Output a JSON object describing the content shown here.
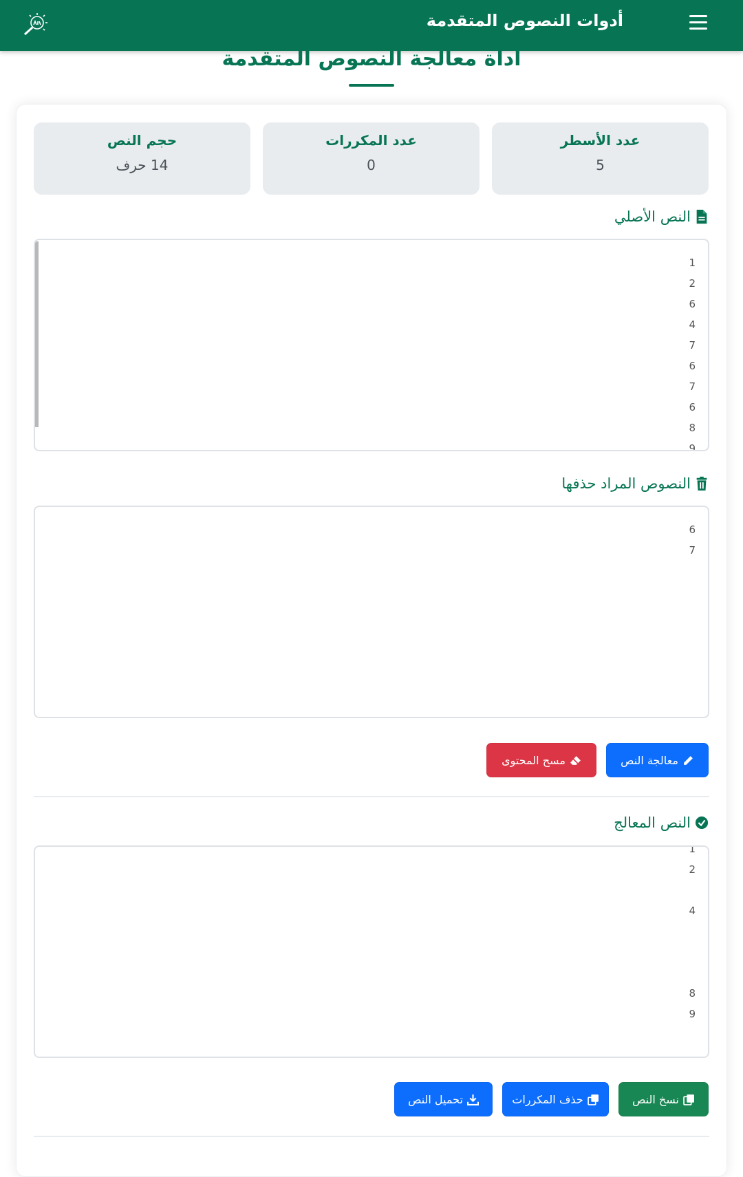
{
  "navbar": {
    "title": "أدوات النصوص المتقدمة",
    "logo_icon": "magnifier-logo-icon",
    "menu_icon": "hamburger-icon",
    "background": "#077554"
  },
  "page": {
    "title": "أداة معالجة النصوص المتقدمة"
  },
  "stats": {
    "lines": {
      "label": "عدد الأسطر",
      "value": "5"
    },
    "duplicates": {
      "label": "عدد المكررات",
      "value": "0"
    },
    "size": {
      "label": "حجم النص",
      "value": "14 حرف"
    }
  },
  "original": {
    "label": "النص الأصلي",
    "icon": "file-icon",
    "lines": [
      "1",
      "2",
      "6",
      "4",
      "7",
      "6",
      "7",
      "6",
      "8",
      "9"
    ]
  },
  "remove": {
    "label": "النصوص المراد حذفها",
    "icon": "trash-icon",
    "lines": [
      "6",
      "7"
    ]
  },
  "actions": {
    "process_label": "معالجة النص",
    "clear_label": "مسح المحتوى"
  },
  "result": {
    "label": "النص المعالج",
    "icon": "check-circle-icon",
    "lines": [
      "1",
      "2",
      "",
      "4",
      "",
      "",
      "",
      "8",
      "9"
    ]
  },
  "result_actions": {
    "copy_label": "نسخ النص",
    "dedupe_label": "حذف المكررات",
    "download_label": "تحميل النص"
  },
  "colors": {
    "primary_green": "#077554",
    "blue": "#0d6efd",
    "red": "#dc3545",
    "green_button": "#198754"
  }
}
